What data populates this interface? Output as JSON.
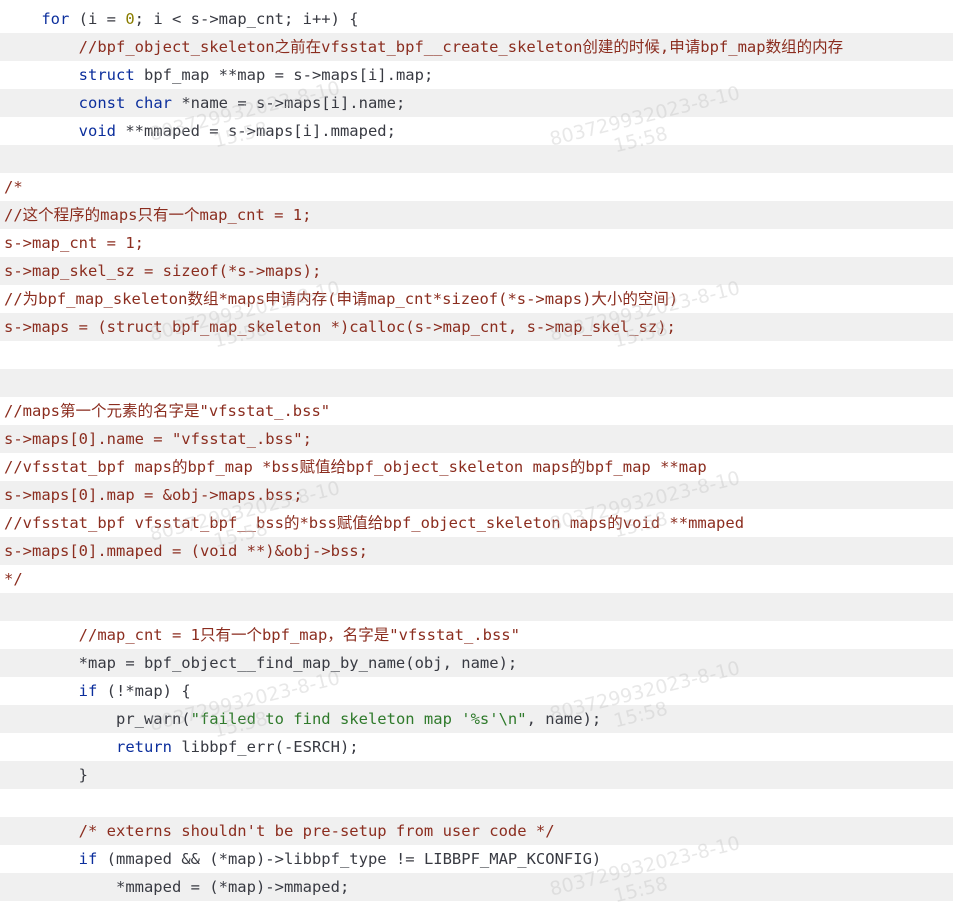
{
  "code_lines": [
    [
      {
        "t": "    "
      },
      {
        "t": "for",
        "c": "kw"
      },
      {
        "t": " (i = "
      },
      {
        "t": "0",
        "c": "nu"
      },
      {
        "t": "; i < s->map_cnt; i++) {"
      }
    ],
    [
      {
        "t": "        "
      },
      {
        "t": "//bpf_object_skeleton之前在vfsstat_bpf__create_skeleton创建的时候,申请bpf_map数组的内存",
        "c": "cm"
      }
    ],
    [
      {
        "t": "        "
      },
      {
        "t": "struct",
        "c": "kw"
      },
      {
        "t": " bpf_map **map = s->maps[i].map;"
      }
    ],
    [
      {
        "t": "        "
      },
      {
        "t": "const",
        "c": "kw"
      },
      {
        "t": " "
      },
      {
        "t": "char",
        "c": "kw"
      },
      {
        "t": " *name = s->maps[i].name;"
      }
    ],
    [
      {
        "t": "        "
      },
      {
        "t": "void",
        "c": "kw"
      },
      {
        "t": " **mmaped = s->maps[i].mmaped;"
      }
    ],
    [
      {
        "t": ""
      }
    ],
    [
      {
        "t": "/*",
        "c": "cm"
      }
    ],
    [
      {
        "t": "//这个程序的maps只有一个map_cnt = 1;",
        "c": "cm"
      }
    ],
    [
      {
        "t": "s->map_cnt = 1;",
        "c": "cm"
      }
    ],
    [
      {
        "t": "s->map_skel_sz = sizeof(*s->maps);",
        "c": "cm"
      }
    ],
    [
      {
        "t": "//为bpf_map_skeleton数组*maps申请内存(申请map_cnt*sizeof(*s->maps)大小的空间)",
        "c": "cm"
      }
    ],
    [
      {
        "t": "s->maps = (struct bpf_map_skeleton *)calloc(s->map_cnt, s->map_skel_sz);",
        "c": "cm"
      }
    ],
    [
      {
        "t": ""
      }
    ],
    [
      {
        "t": ""
      }
    ],
    [
      {
        "t": "//maps第一个元素的名字是\"vfsstat_.bss\"",
        "c": "cm"
      }
    ],
    [
      {
        "t": "s->maps[0].name = \"vfsstat_.bss\";",
        "c": "cm"
      }
    ],
    [
      {
        "t": "//vfsstat_bpf maps的bpf_map *bss赋值给bpf_object_skeleton maps的bpf_map **map",
        "c": "cm"
      }
    ],
    [
      {
        "t": "s->maps[0].map = &obj->maps.bss;",
        "c": "cm"
      }
    ],
    [
      {
        "t": "//vfsstat_bpf vfsstat_bpf__bss的*bss赋值给bpf_object_skeleton maps的void **mmaped",
        "c": "cm"
      }
    ],
    [
      {
        "t": "s->maps[0].mmaped = (void **)&obj->bss;",
        "c": "cm"
      }
    ],
    [
      {
        "t": "*/",
        "c": "cm"
      }
    ],
    [
      {
        "t": ""
      }
    ],
    [
      {
        "t": "        "
      },
      {
        "t": "//map_cnt = 1只有一个bpf_map，名字是\"vfsstat_.bss\"",
        "c": "cm"
      }
    ],
    [
      {
        "t": "        *map = bpf_object__find_map_by_name(obj, name);"
      }
    ],
    [
      {
        "t": "        "
      },
      {
        "t": "if",
        "c": "kw"
      },
      {
        "t": " (!*map) {"
      }
    ],
    [
      {
        "t": "            pr_warn("
      },
      {
        "t": "\"failed to find skeleton map '%s'\\n\"",
        "c": "st"
      },
      {
        "t": ", name);"
      }
    ],
    [
      {
        "t": "            "
      },
      {
        "t": "return",
        "c": "kw"
      },
      {
        "t": " libbpf_err(-ESRCH);"
      }
    ],
    [
      {
        "t": "        }"
      }
    ],
    [
      {
        "t": ""
      }
    ],
    [
      {
        "t": "        "
      },
      {
        "t": "/* externs shouldn't be pre-setup from user code */",
        "c": "cm"
      }
    ],
    [
      {
        "t": "        "
      },
      {
        "t": "if",
        "c": "kw"
      },
      {
        "t": " (mmaped && (*map)->libbpf_type != LIBBPF_MAP_KCONFIG)"
      }
    ],
    [
      {
        "t": "            *mmaped = (*map)->mmaped;"
      }
    ]
  ],
  "watermark": {
    "id_text": "80372993",
    "date_text": "2023-8-10",
    "time_text": "15:58"
  }
}
